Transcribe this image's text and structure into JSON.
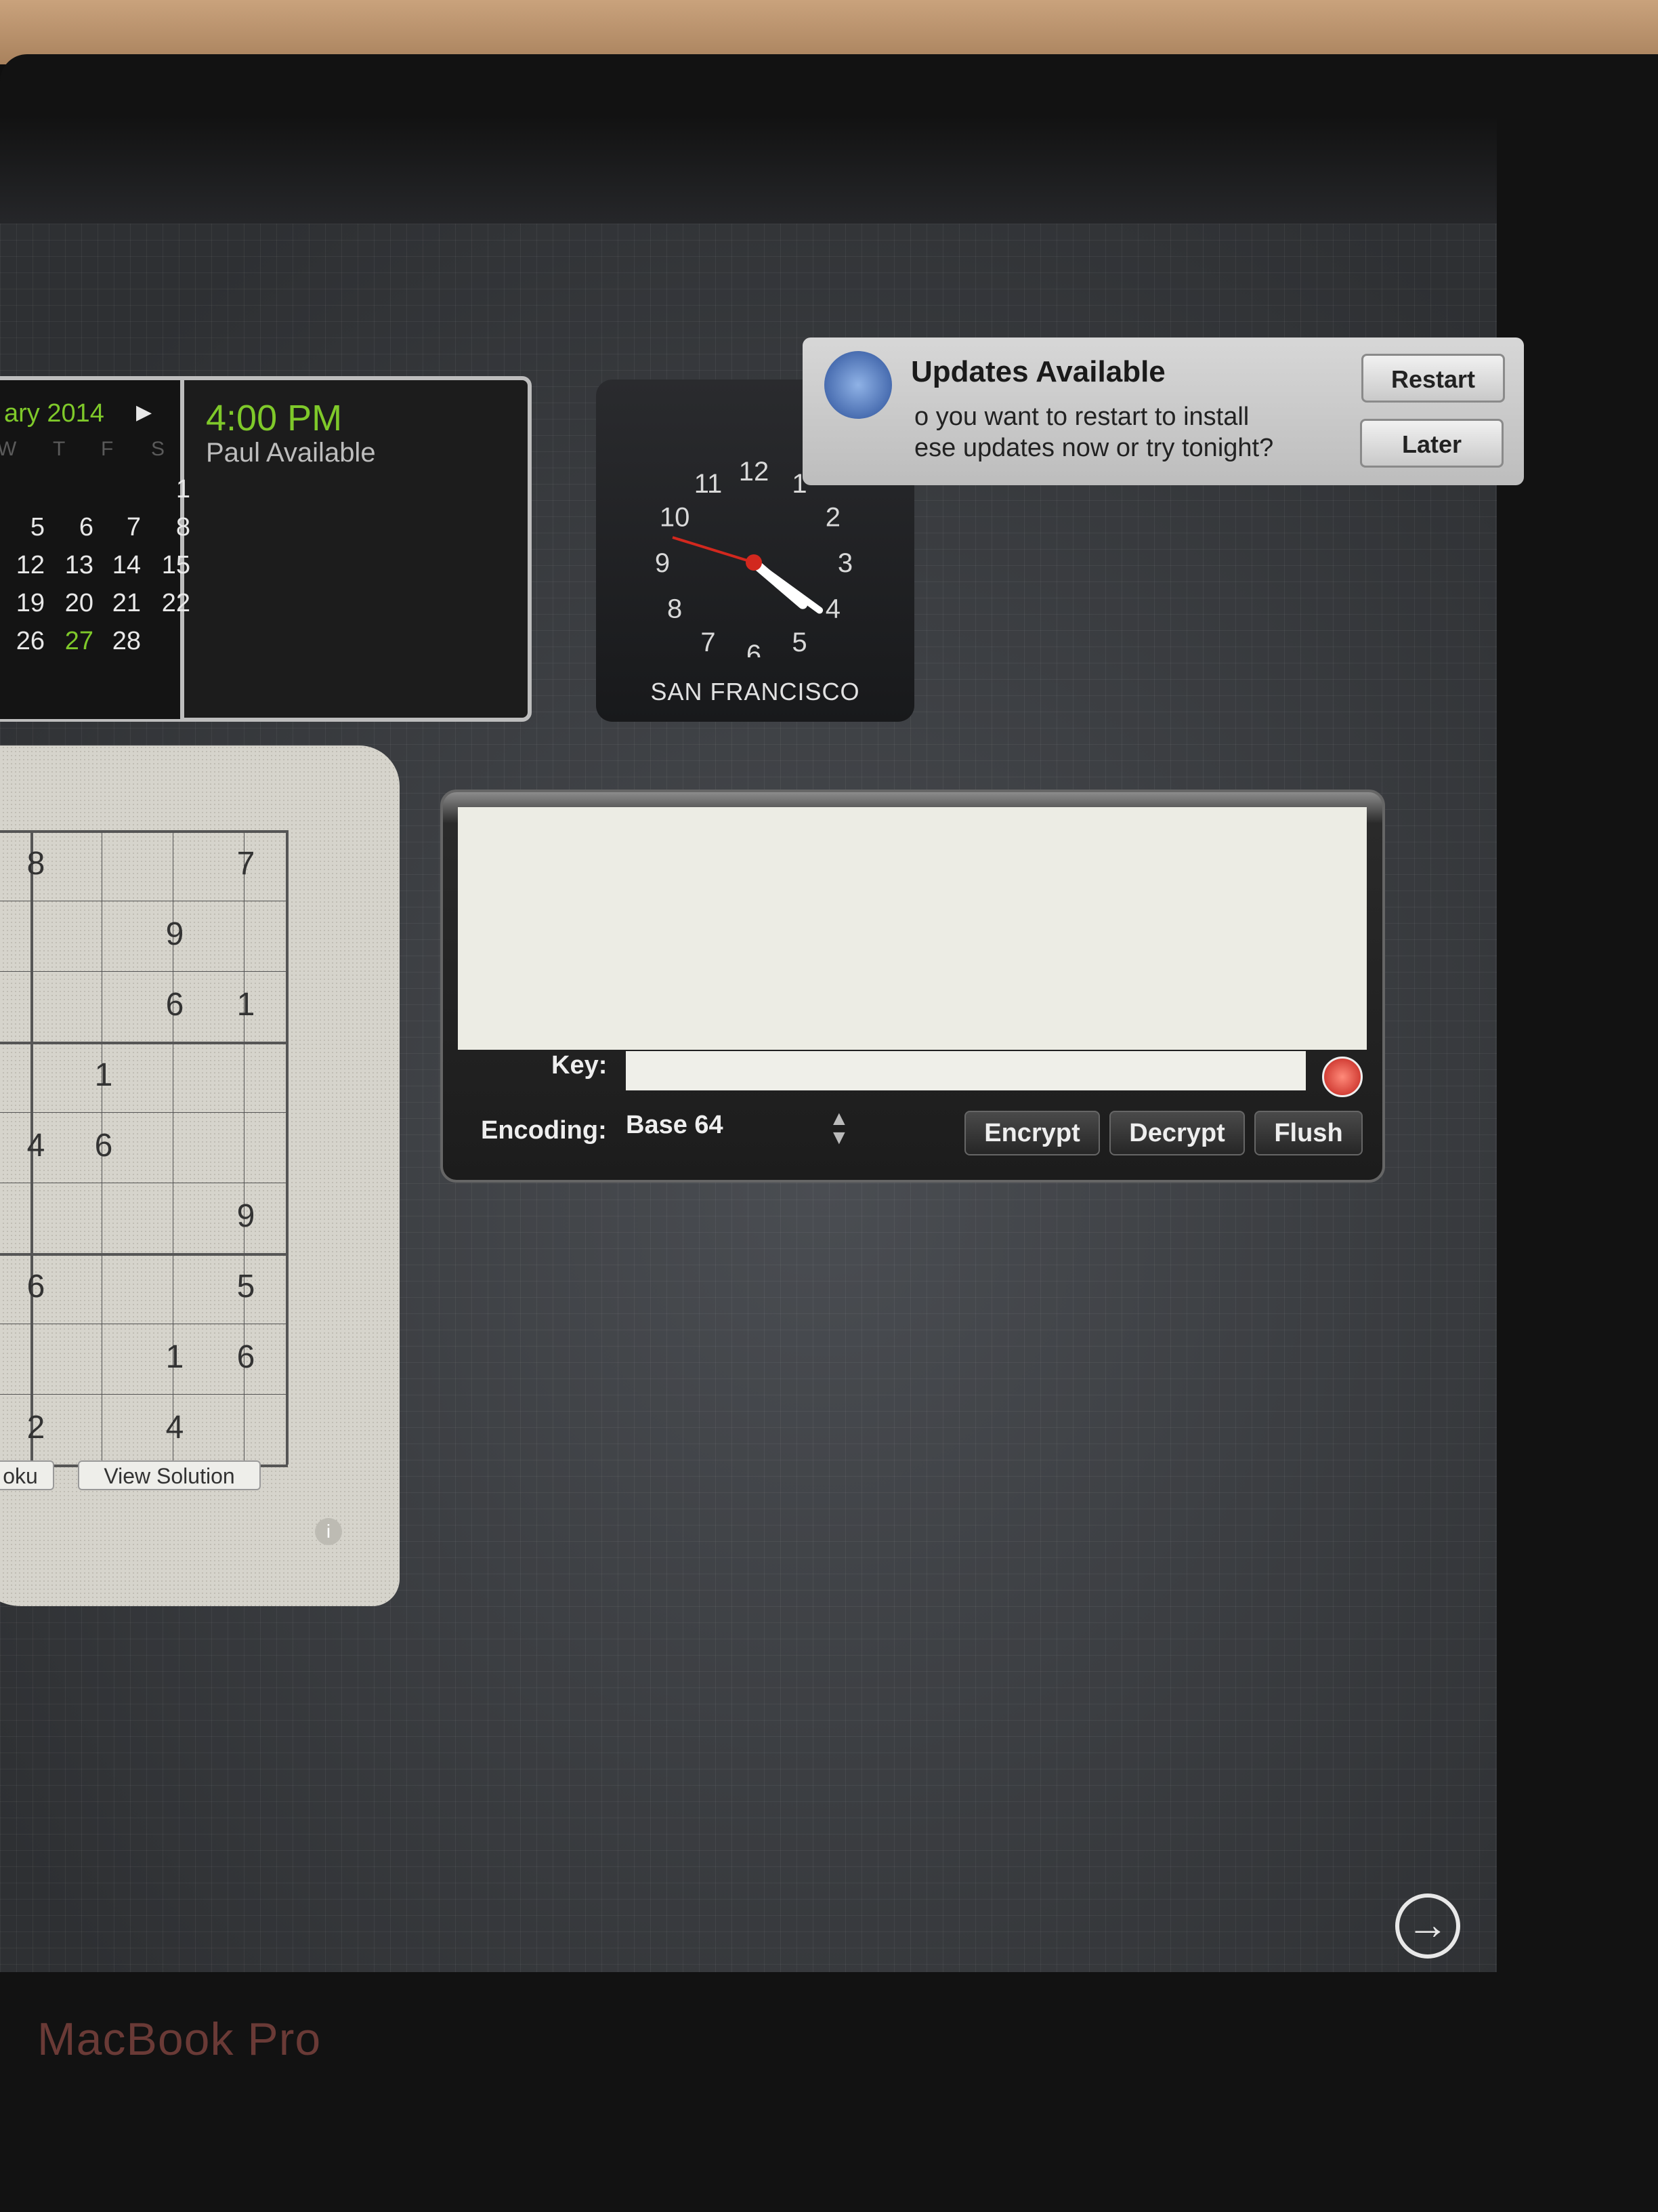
{
  "calendar": {
    "month_label": "ary 2014",
    "weekday_headers": [
      "W",
      "T",
      "F",
      "S"
    ],
    "weeks": [
      [
        "",
        "",
        "",
        "1"
      ],
      [
        "5",
        "6",
        "7",
        "8"
      ],
      [
        "12",
        "13",
        "14",
        "15"
      ],
      [
        "19",
        "20",
        "21",
        "22"
      ],
      [
        "26",
        "27",
        "28",
        ""
      ]
    ],
    "today": "27",
    "event_time": "4:00 PM",
    "event_text": "Paul Available"
  },
  "clock": {
    "numbers": [
      "12",
      "1",
      "2",
      "3",
      "4",
      "5",
      "6",
      "7",
      "8",
      "9",
      "10",
      "11"
    ],
    "city": "SAN FRANCISCO",
    "time_shown": "4:21"
  },
  "updates": {
    "title": "Updates Available",
    "message_line1": "o you want to restart to install",
    "message_line2": "ese updates now or try tonight?",
    "restart_label": "Restart",
    "later_label": "Later"
  },
  "sudoku": {
    "rows": [
      [
        "8",
        "",
        "",
        "7"
      ],
      [
        "",
        "",
        "9",
        ""
      ],
      [
        "",
        "",
        "6",
        "1"
      ],
      [
        "",
        "1",
        "",
        ""
      ],
      [
        "4",
        "6",
        "",
        ""
      ],
      [
        "",
        "",
        "",
        "9"
      ],
      [
        "6",
        "",
        "",
        "5"
      ],
      [
        "",
        "",
        "1",
        "6"
      ],
      [
        "2",
        "",
        "4",
        ""
      ]
    ],
    "new_label": "oku",
    "solution_label": "View Solution",
    "info_icon": "i"
  },
  "cipher": {
    "key_label": "Key:",
    "key_value": "",
    "encoding_label": "Encoding:",
    "encoding_value": "Base 64",
    "encrypt_label": "Encrypt",
    "decrypt_label": "Decrypt",
    "flush_label": "Flush"
  },
  "footer": {
    "brand": "MacBook Pro",
    "exit_icon": "→"
  }
}
